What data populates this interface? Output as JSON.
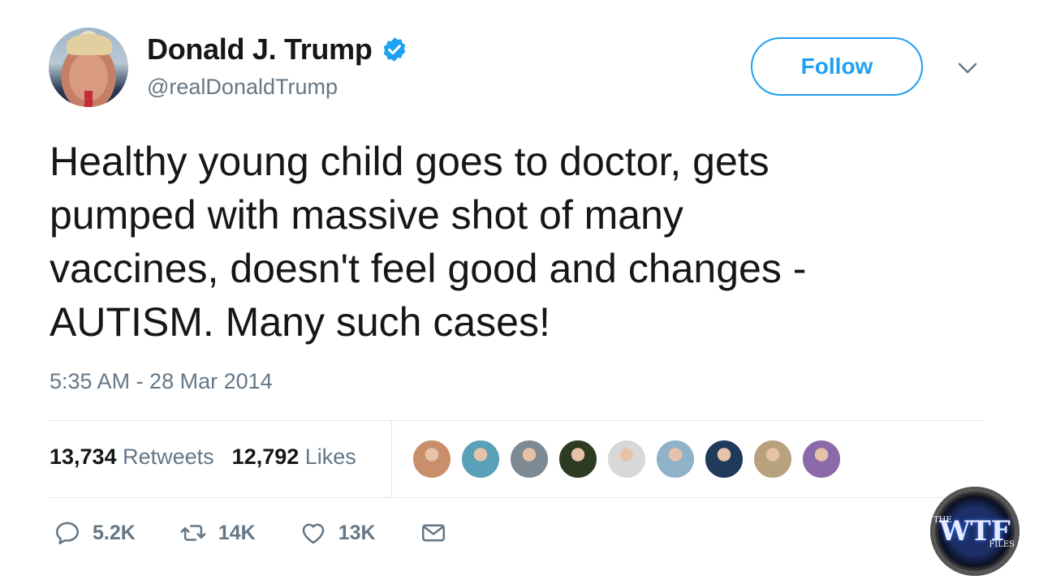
{
  "user": {
    "display_name": "Donald J. Trump",
    "handle": "@realDonaldTrump",
    "verified": true
  },
  "follow_label": "Follow",
  "tweet": {
    "text": "Healthy young child goes to doctor, gets\npumped with massive shot of many\nvaccines, doesn't feel good and changes -\nAUTISM. Many such cases!",
    "timestamp": "5:35 AM - 28 Mar 2014"
  },
  "stats": {
    "retweets_count": "13,734",
    "retweets_label": "Retweets",
    "likes_count": "12,792",
    "likes_label": "Likes"
  },
  "likers_avatar_colors": [
    "#c98f6a",
    "#5aa0b8",
    "#7d8a94",
    "#2d3b22",
    "#d8d8d8",
    "#8fb2c9",
    "#1f3a5a",
    "#b8a27e",
    "#8a6aa8"
  ],
  "actions": {
    "reply_count": "5.2K",
    "retweet_count": "14K",
    "like_count": "13K"
  },
  "watermark": {
    "top": "THE",
    "main": "WTF",
    "bottom": "FILES"
  },
  "colors": {
    "accent": "#1da1f2",
    "secondary_text": "#657786",
    "primary_text": "#14171a"
  }
}
